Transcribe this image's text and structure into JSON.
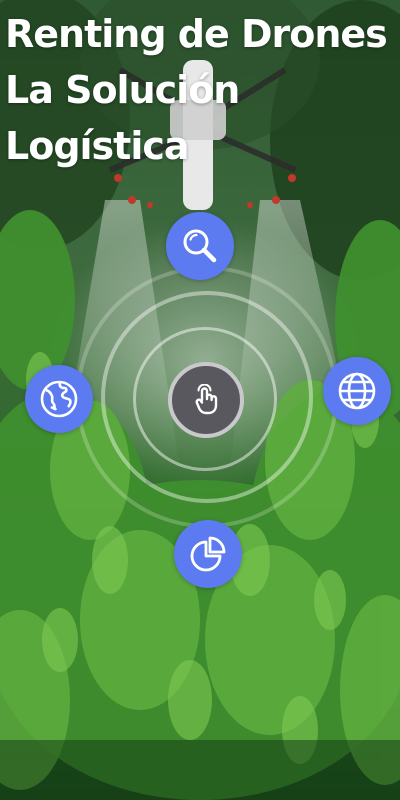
{
  "header": {
    "title_line1": "Renting de Drones",
    "title_line2": "La Solución",
    "title_line3": "Logística"
  },
  "menu": {
    "center_icon": "tap-hand-icon",
    "top_icon": "search-icon",
    "left_icon": "earth-icon",
    "right_icon": "globe-icon",
    "bottom_icon": "pie-chart-icon"
  },
  "colors": {
    "accent": "#5c7bf0",
    "center_button": "#58585e",
    "text": "#ffffff"
  }
}
